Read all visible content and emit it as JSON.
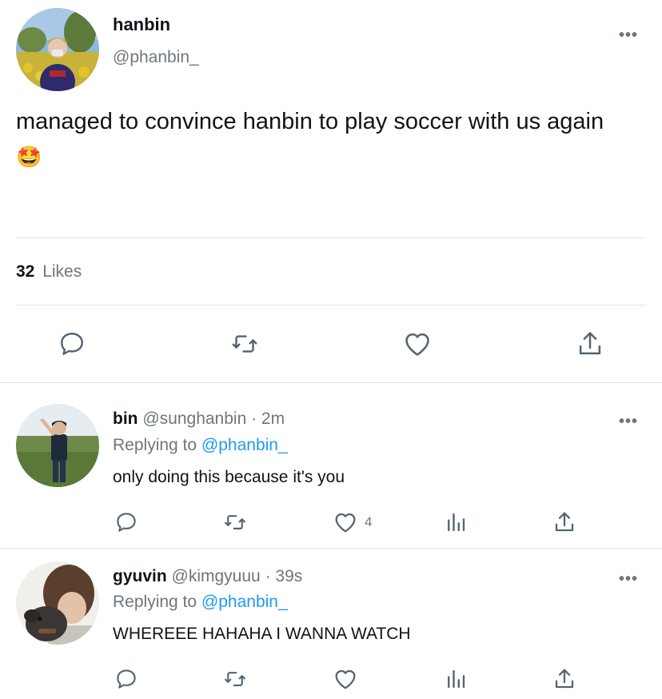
{
  "main_tweet": {
    "display_name": "hanbin",
    "handle": "@phanbin_",
    "text": "managed to convince hanbin to play soccer with us again",
    "emoji": "🤩",
    "likes_count": "32",
    "likes_label": "Likes"
  },
  "replies": [
    {
      "display_name": "bin",
      "handle": "@sunghanbin",
      "time": "· 2m",
      "replying_prefix": "Replying to",
      "replying_to": "@phanbin_",
      "text": "only doing this because it's you",
      "like_count": "4"
    },
    {
      "display_name": "gyuvin",
      "handle": "@kimgyuuu",
      "time": "· 39s",
      "replying_prefix": "Replying to",
      "replying_to": "@phanbin_",
      "text": "WHEREEE HAHAHA I WANNA WATCH",
      "like_count": ""
    }
  ],
  "more_glyph": "•••",
  "colors": {
    "link": "#1d9bf0",
    "muted": "#6e767d",
    "divider": "#e1e4e8"
  }
}
